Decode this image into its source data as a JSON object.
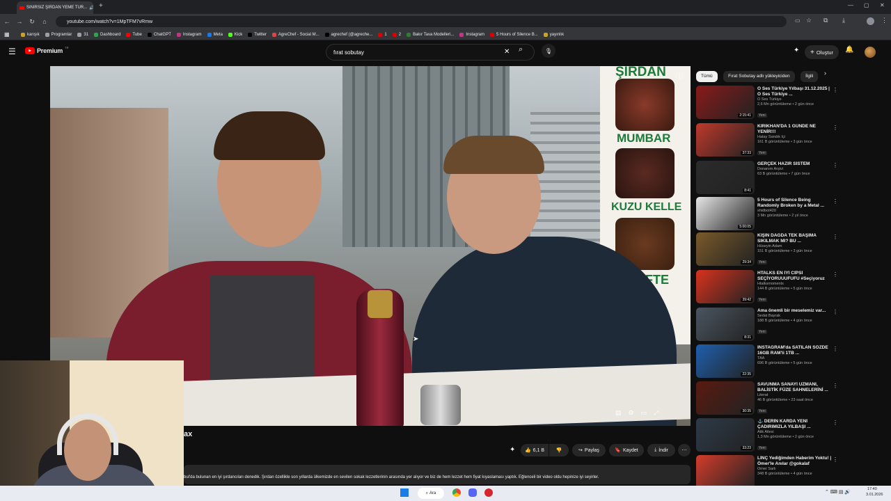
{
  "browser": {
    "tab_title": "SINIRSIZ ŞIRDAN YEME TUR...",
    "url": "youtube.com/watch?v=1MpTFM7vRmw",
    "bookmarks": [
      "karışık",
      "Programlar",
      "31",
      "Dashboard",
      "Tube",
      "ChatGPT",
      "Instagram",
      "Meta",
      "Kick",
      "Twitter",
      "AgreChef - Social M...",
      "agrechef (@agreche...",
      "1",
      "2",
      "Bakır Tava Modelleri...",
      "Instagram",
      "5 Hours of Silence B...",
      "yayınlık"
    ]
  },
  "header": {
    "logo": "Premium",
    "logo_sup": "TR",
    "search_value": "fırat sobutay",
    "create_label": "Oluştur"
  },
  "video": {
    "sign_words": [
      "ŞIRDAN",
      "MUMBAR",
      "KUZU KELLE",
      "KÖFTE"
    ],
    "title_fragment": "ax"
  },
  "actions": {
    "likes": "6,1 B",
    "share": "Paylaş",
    "save": "Kaydet",
    "download": "İndir"
  },
  "description": "bul'da bulunan en iyi şırdancıları denedik. Şırdan özellikle son yıllarda ülkemizde en sevilen sokak lezzetlerinin arasında yer alıyor ve biz de hem lezzet hem fiyat kıyaslaması yaptık. Eğlenceli bir video oldu hepinize iyi seyirler.",
  "sidebar": {
    "chips": [
      "Tümü",
      "Fırat Sobutay adlı yükleyiciden",
      "İlgili"
    ],
    "items": [
      {
        "title": "O Ses Türkiye Yılbaşı 31.12.2025 | O Ses Türkiye ...",
        "channel": "O Ses Türkiye",
        "meta": "2,6 Mn görüntüleme • 2 gün önce",
        "badge": "Yeni",
        "duration": "2:15:41",
        "color": "#8a1a1a"
      },
      {
        "title": "KIRIKHAN'DA 1 GÜNDE NE YENİR!!!",
        "channel": "Hatay Sandık İçi",
        "meta": "161 B görüntüleme • 3 gün önce",
        "badge": "Yeni",
        "duration": "37:33",
        "color": "#c0392b"
      },
      {
        "title": "GERÇEK HAZIR SİSTEM",
        "channel": "Donanım Arşivi",
        "meta": "63 B görüntüleme • 7 gün önce",
        "badge": "",
        "duration": "8:41",
        "color": "#2b2b2b"
      },
      {
        "title": "5 Hours of Silence Being Randomly Broken by a Metal ...",
        "channel": "shidbot420",
        "meta": "3 Mn görüntüleme • 2 yıl önce",
        "badge": "",
        "duration": "5:00:05",
        "color": "#e6e6e6"
      },
      {
        "title": "KIŞIN DAĞDA TEK BAŞIMA SIKILMAK MI? BU ...",
        "channel": "Hüseyin Adam",
        "meta": "151 B görüntüleme • 3 gün önce",
        "badge": "Yeni",
        "duration": "29:34",
        "color": "#7a5a2a"
      },
      {
        "title": "HTALKS EN İYİ CİPSİ SEÇİYORUUUFUFU #Seçiyoruz",
        "channel": "Htalksmoments",
        "meta": "144 B görüntüleme • 5 gün önce",
        "badge": "Yeni",
        "duration": "39:42",
        "color": "#d8321e"
      },
      {
        "title": "Ama önemli bir meselemiz var...",
        "channel": "Sedat Bayrak",
        "meta": "188 B görüntüleme • 4 gün önce",
        "badge": "Yeni",
        "duration": "8:31",
        "color": "#4a5560"
      },
      {
        "title": "INSTAGRAM'da SATILAN SÖZDE 16GB RAM'li 1TB ...",
        "channel": "TAA",
        "meta": "696 B görüntüleme • 5 gün önce",
        "badge": "",
        "duration": "22:35",
        "color": "#1f5fae"
      },
      {
        "title": "SAVUNMA SANAYİ UZMANI, BALİSTİK FÜZE SAHNELERİNİ ...",
        "channel": "Literat",
        "meta": "46 B görüntüleme • 23 saat önce",
        "badge": "Yeni",
        "duration": "30:35",
        "color": "#5a1a10"
      },
      {
        "title": "⚓ DERİN KARDA YENİ ÇADIRIMIZLA YILBAŞI ...",
        "channel": "Atik Ailesi",
        "meta": "1,3 Mn görüntüleme • 2 gün önce",
        "badge": "Yeni",
        "duration": "33:23",
        "color": "#2d3a48"
      },
      {
        "title": "LİNÇ Yediğimden Haberim Yoktu! | Ömer'le Anılar @gokalaf",
        "channel": "Ömer Sarlı",
        "meta": "348 B görüntüleme • 4 gün önce",
        "badge": "",
        "duration": "",
        "color": "#d43c2c"
      }
    ]
  },
  "taskbar": {
    "search": "Ara",
    "time": "17:40",
    "date": "3.01.2026"
  },
  "colors": {
    "brand": "#ff0000",
    "bg": "#0f0f0f"
  }
}
